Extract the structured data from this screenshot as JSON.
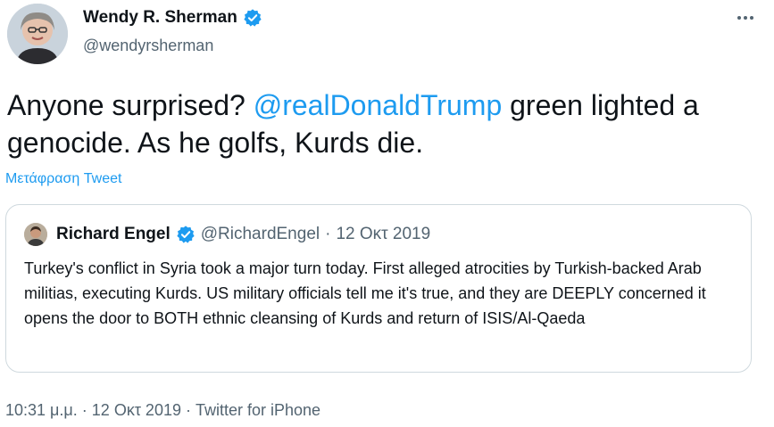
{
  "author": {
    "name": "Wendy R. Sherman",
    "handle": "@wendyrsherman",
    "verified_color": "#1d9bf0"
  },
  "more_icon": "more-horizontal-icon",
  "tweet": {
    "text_before": "Anyone surprised? ",
    "mention": "@realDonaldTrump",
    "text_after": " green lighted a genocide. As he golfs, Kurds die."
  },
  "translate_label": "Μετάφραση Tweet",
  "quote": {
    "name": "Richard Engel",
    "handle": "@RichardEngel",
    "separator": "·",
    "date": "12 Οκτ 2019",
    "text": "Turkey's conflict in Syria took a major turn today. First alleged atrocities by Turkish-backed Arab militias, executing Kurds. US military officials tell me it's true, and they are DEEPLY concerned it opens the door to BOTH ethnic cleansing of Kurds and return of ISIS/Al-Qaeda"
  },
  "footer": {
    "time": "10:31 μ.μ.",
    "separator": " · ",
    "date": "12 Οκτ 2019",
    "source": "Twitter for iPhone"
  },
  "colors": {
    "link": "#1d9bf0",
    "text": "#0f1419",
    "secondary": "#536471",
    "border": "#cfd9de"
  }
}
